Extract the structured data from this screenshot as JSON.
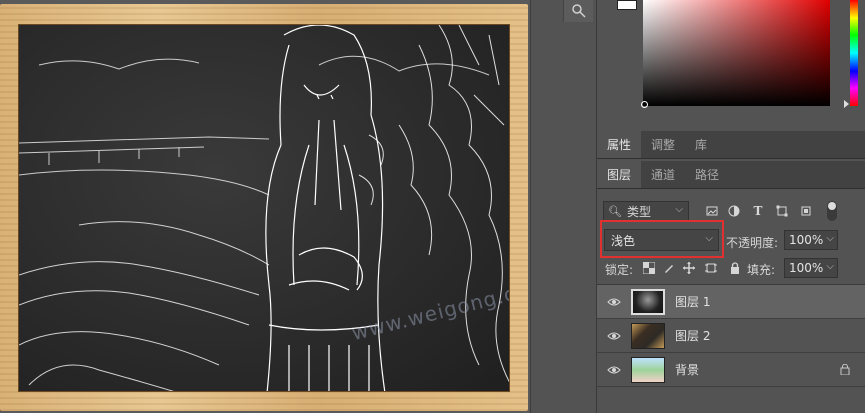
{
  "canvas": {
    "watermark": "www.weigong.com"
  },
  "toolstrip": {
    "tool_icon": "quick-selection-icon"
  },
  "colors": {
    "foreground": "#ffffff",
    "picker_hue": "#e00000",
    "highlight": "#e03030"
  },
  "props_tabs": [
    {
      "label": "属性",
      "active": true
    },
    {
      "label": "调整",
      "active": false
    },
    {
      "label": "库",
      "active": false
    }
  ],
  "layers_tabs": [
    {
      "label": "图层",
      "active": true
    },
    {
      "label": "通道",
      "active": false
    },
    {
      "label": "路径",
      "active": false
    }
  ],
  "filter": {
    "kind_label": "类型",
    "icons": [
      "pixel-filter-icon",
      "adjustment-filter-icon",
      "type-filter-icon",
      "shape-filter-icon",
      "smart-object-filter-icon"
    ]
  },
  "blend": {
    "mode": "浅色",
    "opacity_label": "不透明度:",
    "opacity_value": "100%"
  },
  "lock": {
    "label": "锁定:",
    "fill_label": "填充:",
    "fill_value": "100%"
  },
  "layers": [
    {
      "name": "图层 1",
      "visible": true,
      "selected": true,
      "locked": false
    },
    {
      "name": "图层 2",
      "visible": true,
      "selected": false,
      "locked": false
    },
    {
      "name": "背景",
      "visible": true,
      "selected": false,
      "locked": true
    }
  ]
}
